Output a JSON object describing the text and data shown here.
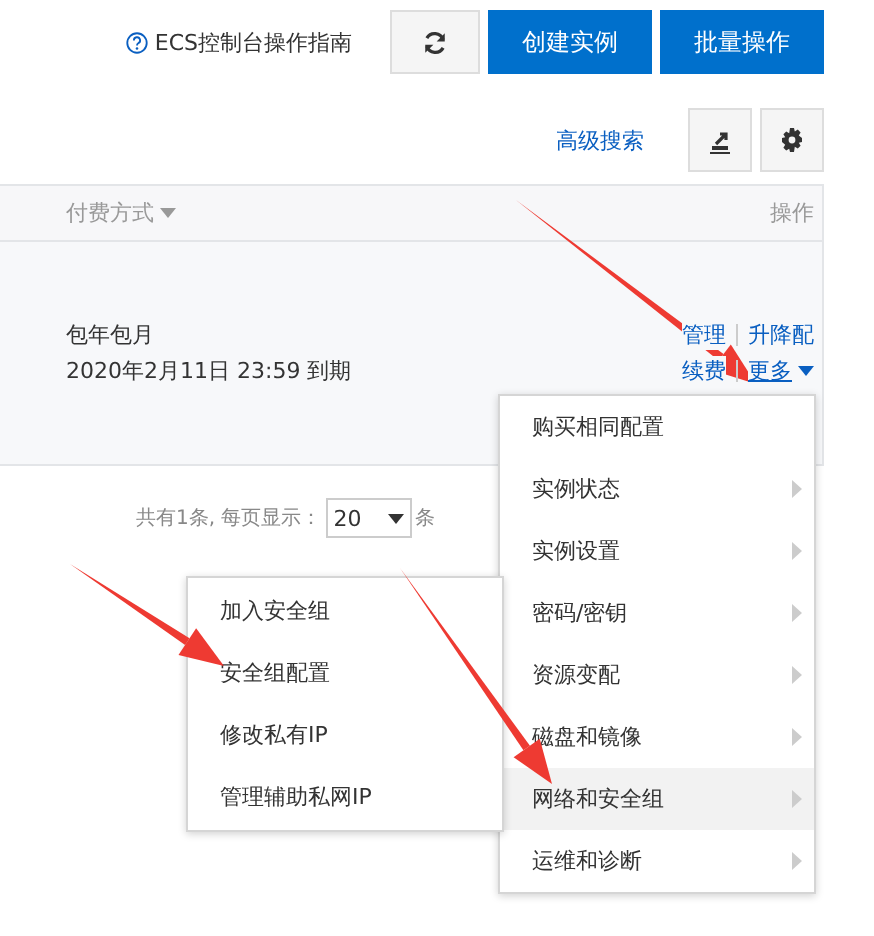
{
  "help_link": "ECS控制台操作指南",
  "toolbar": [
    {
      "kind": "refresh"
    },
    {
      "kind": "primary",
      "label": "创建实例"
    },
    {
      "kind": "primary",
      "label": "批量操作"
    }
  ],
  "search_bar": {
    "advanced_search": "高级搜索",
    "icon_buttons": [
      {
        "kind": "export"
      },
      {
        "kind": "settings"
      }
    ]
  },
  "table": {
    "columns": [
      {
        "label": "付费方式",
        "sortable": true
      },
      {
        "label": "操作",
        "sortable": false
      }
    ],
    "rows": [
      {
        "billing": [
          "包年包月",
          "2020年2月11日 23:59 到期"
        ],
        "actions": [
          [
            {
              "label": "管理",
              "kind": "link",
              "selected": false
            },
            {
              "label": "升降配",
              "kind": "link",
              "selected": false
            }
          ],
          [
            {
              "label": "续费",
              "kind": "link",
              "selected": false
            },
            {
              "label": "更多",
              "kind": "dropdown",
              "selected": true
            }
          ]
        ]
      }
    ]
  },
  "pagination": {
    "summary": "共有1条, 每页显示：",
    "page_size": "20",
    "unit": "条"
  },
  "more_menu": {
    "items": [
      {
        "label": "购买相同配置",
        "submenu": false,
        "selected": false
      },
      {
        "label": "实例状态",
        "submenu": true,
        "selected": false
      },
      {
        "label": "实例设置",
        "submenu": true,
        "selected": false
      },
      {
        "label": "密码/密钥",
        "submenu": true,
        "selected": false
      },
      {
        "label": "资源变配",
        "submenu": true,
        "selected": false
      },
      {
        "label": "磁盘和镜像",
        "submenu": true,
        "selected": false
      },
      {
        "label": "网络和安全组",
        "submenu": true,
        "selected": true
      },
      {
        "label": "运维和诊断",
        "submenu": true,
        "selected": false
      }
    ]
  },
  "network_submenu": {
    "items": [
      "加入安全组",
      "安全组配置",
      "修改私有IP",
      "管理辅助私网IP"
    ]
  }
}
